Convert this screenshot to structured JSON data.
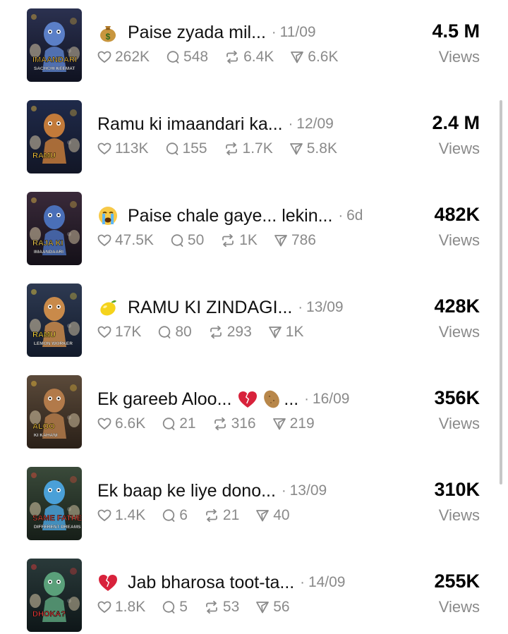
{
  "videos": [
    {
      "emoji": "money-bag-icon",
      "title": "Paise zyada mil...",
      "date": "11/09",
      "likes": "262K",
      "comments": "548",
      "reposts": "6.4K",
      "shares": "6.6K",
      "views": "4.5 M",
      "views_label": "Views",
      "thumb_text": [
        "IMAANDARI",
        "SACHCHI KEEMAT"
      ]
    },
    {
      "emoji": "",
      "title": "Ramu ki imaandari ka...",
      "date": "12/09",
      "likes": "113K",
      "comments": "155",
      "reposts": "1.7K",
      "shares": "5.8K",
      "views": "2.4 M",
      "views_label": "Views",
      "thumb_text": [
        "RAMU"
      ]
    },
    {
      "emoji": "crying-face-icon",
      "title": "Paise chale gaye... lekin...",
      "date": "6d",
      "likes": "47.5K",
      "comments": "50",
      "reposts": "1K",
      "shares": "786",
      "views": "482K",
      "views_label": "Views",
      "thumb_text": [
        "RAJA KI",
        "IMAANDAARI"
      ]
    },
    {
      "emoji": "lemon-icon",
      "title": "RAMU KI ZINDAGI...",
      "date": "13/09",
      "likes": "17K",
      "comments": "80",
      "reposts": "293",
      "shares": "1K",
      "views": "428K",
      "views_label": "Views",
      "thumb_text": [
        "RAMU",
        "LEMON WORKER"
      ]
    },
    {
      "emoji": "",
      "title": "Ek gareeb Aloo...",
      "title_emojis": [
        "broken-heart-icon",
        "potato-icon"
      ],
      "title_tail": "...",
      "date": "16/09",
      "likes": "6.6K",
      "comments": "21",
      "reposts": "316",
      "shares": "219",
      "views": "356K",
      "views_label": "Views",
      "thumb_text": [
        "ALOO",
        "KI KAHANI"
      ]
    },
    {
      "emoji": "",
      "title": "Ek baap ke liye dono...",
      "date": "13/09",
      "likes": "1.4K",
      "comments": "6",
      "reposts": "21",
      "shares": "40",
      "views": "310K",
      "views_label": "Views",
      "thumb_text": [
        "SAME FATHER",
        "DIFFERENT DREAMS"
      ]
    },
    {
      "emoji": "broken-heart-icon",
      "title": "Jab bharosa toot-ta...",
      "date": "14/09",
      "likes": "1.8K",
      "comments": "5",
      "reposts": "53",
      "shares": "56",
      "views": "255K",
      "views_label": "Views",
      "thumb_text": [
        "DHOKA?"
      ]
    }
  ],
  "colors": {
    "muted": "#8a8a8a",
    "primary": "#000000"
  }
}
